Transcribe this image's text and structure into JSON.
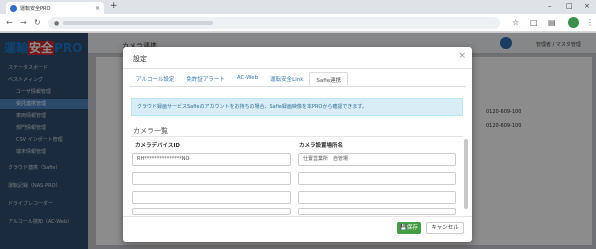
{
  "browser": {
    "tab_title": "運転安全PRO",
    "close_glyph": "×",
    "new_tab_glyph": "+"
  },
  "app": {
    "logo_left": "運輸",
    "logo_mid": "安全",
    "logo_right": "PRO",
    "sidebar": [
      {
        "label": "ステータスボード"
      },
      {
        "label": "ベスト〆ィング"
      },
      {
        "label": "ユーザ情報管理"
      },
      {
        "label": "受託連携管理"
      },
      {
        "label": "車両情報管理"
      },
      {
        "label": "部門情報管理"
      },
      {
        "label": "CSV インポート管理"
      },
      {
        "label": "端末情報管理"
      },
      {
        "label": "クラウド連携（Safie）"
      },
      {
        "label": "運転記録（NAS-PRO）"
      },
      {
        "label": "ドライブレコーダー"
      },
      {
        "label": "アルコール検知（AC-Web）"
      }
    ],
    "page_title": "カメラ連携",
    "user_label": "管理者 / マスタ管理",
    "bg_phone_1": "0120-609-100",
    "bg_phone_2": "0120-609-100"
  },
  "modal": {
    "title": "設定",
    "close_glyph": "×",
    "tabs": [
      "アルコール設定",
      "免許証アラート",
      "AC-Web",
      "運転安全Link",
      "Safie連携"
    ],
    "active_tab_index": 4,
    "info_text": "クラウド録画サービスSafieのアカウントをお持ちの場合、Safie録画映像を本PROから確認できます。",
    "section_title": "カメラ一覧",
    "col_device_id": "カメラデバイスID",
    "col_location": "カメラ設置場所名",
    "rows": [
      {
        "device_id": "RH***************NO",
        "location": "仕置営業所　自管場"
      },
      {
        "device_id": "",
        "location": ""
      },
      {
        "device_id": "",
        "location": ""
      },
      {
        "device_id": "",
        "location": ""
      }
    ],
    "save_label": "保存",
    "cancel_label": "キャンセル"
  }
}
